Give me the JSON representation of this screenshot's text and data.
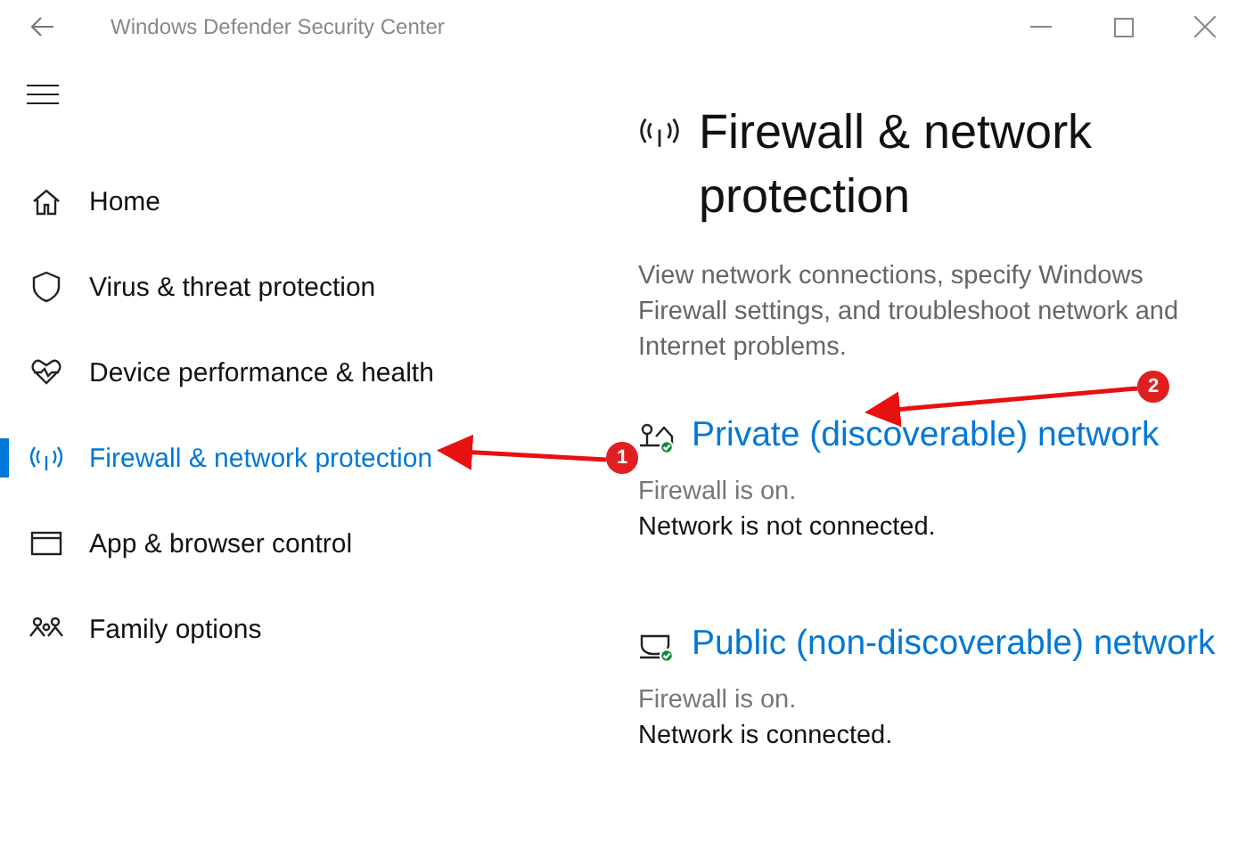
{
  "window": {
    "title": "Windows Defender Security Center"
  },
  "sidebar": {
    "items": [
      {
        "label": "Home",
        "kind": "home",
        "selected": false
      },
      {
        "label": "Virus & threat protection",
        "kind": "shield",
        "selected": false
      },
      {
        "label": "Device performance & health",
        "kind": "heart",
        "selected": false
      },
      {
        "label": "Firewall & network protection",
        "kind": "antenna",
        "selected": true
      },
      {
        "label": "App & browser control",
        "kind": "window",
        "selected": false
      },
      {
        "label": "Family options",
        "kind": "family",
        "selected": false
      }
    ]
  },
  "page": {
    "title": "Firewall & network protection",
    "description": "View network connections, specify Windows Firewall settings, and troubleshoot network and Internet problems."
  },
  "networks": [
    {
      "kind": "private",
      "name": "Private (discoverable) network",
      "firewall": "Firewall is on.",
      "connection": "Network is not connected."
    },
    {
      "kind": "public",
      "name": "Public (non-discoverable) network",
      "firewall": "Firewall is on.",
      "connection": "Network is connected."
    }
  ],
  "annotations": [
    {
      "label": "1"
    },
    {
      "label": "2"
    }
  ]
}
